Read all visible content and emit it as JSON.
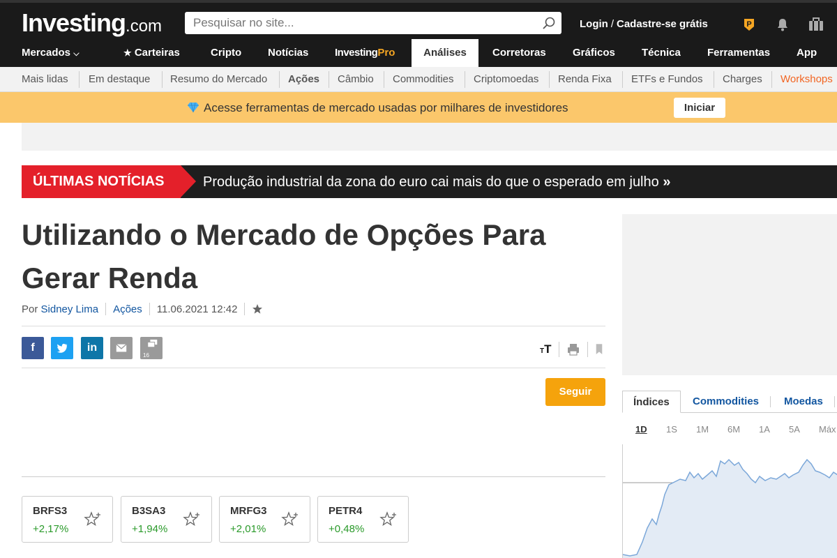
{
  "header": {
    "logo_main": "Investing",
    "logo_suffix": ".com",
    "search_placeholder": "Pesquisar no site...",
    "login": "Login",
    "signup": "Cadastre-se grátis"
  },
  "main_nav": [
    {
      "label": "Mercados",
      "has_dropdown": true
    },
    {
      "label": "Carteiras",
      "icon": "star-icon"
    },
    {
      "label": "Cripto"
    },
    {
      "label": "Notícias"
    },
    {
      "label_main": "Investing",
      "label_accent": "Pro"
    },
    {
      "label": "Análises",
      "active": true
    },
    {
      "label": "Corretoras"
    },
    {
      "label": "Gráficos"
    },
    {
      "label": "Técnica"
    },
    {
      "label": "Ferramentas"
    },
    {
      "label": "App"
    }
  ],
  "sub_nav": [
    "Mais lidas",
    "Em destaque",
    "Resumo do Mercado",
    "Ações",
    "Câmbio",
    "Commodities",
    "Criptomoedas",
    "Renda Fixa",
    "ETFs e Fundos",
    "Charges",
    "Workshops"
  ],
  "promo": {
    "text": "Acesse ferramentas de mercado usadas por milhares de investidores",
    "button": "Iniciar"
  },
  "breaking": {
    "label": "ÚLTIMAS NOTÍCIAS",
    "headline": "Produção industrial da zona do euro cai mais do que o esperado em julho",
    "chevron": "»"
  },
  "article": {
    "title": "Utilizando o Mercado de Opções Para Gerar Renda",
    "by_prefix": "Por",
    "author": "Sidney Lima",
    "category": "Ações",
    "datetime": "11.06.2021 12:42",
    "comment_count": "16",
    "follow_button": "Seguir"
  },
  "share": {
    "facebook": "f",
    "linkedin": "in"
  },
  "tools": {
    "font_size_small": "T",
    "font_size_large": "T"
  },
  "tickers": [
    {
      "symbol": "BRFS3",
      "change": "+2,17%"
    },
    {
      "symbol": "B3SA3",
      "change": "+1,94%"
    },
    {
      "symbol": "MRFG3",
      "change": "+2,01%"
    },
    {
      "symbol": "PETR4",
      "change": "+0,48%"
    }
  ],
  "sidebar": {
    "tabs": [
      "Índices",
      "Commodities",
      "Moedas"
    ],
    "active_tab": "Índices",
    "periods": [
      "1D",
      "1S",
      "1M",
      "6M",
      "1A",
      "5A",
      "Máx"
    ],
    "active_period": "1D"
  },
  "colors": {
    "header_bg": "#1a1a1a",
    "breaking_red": "#e4202a",
    "promo_bg": "#fbc76b",
    "follow_orange": "#f5a30c",
    "link_blue": "#1256a0",
    "positive_green": "#2a9a2a"
  }
}
